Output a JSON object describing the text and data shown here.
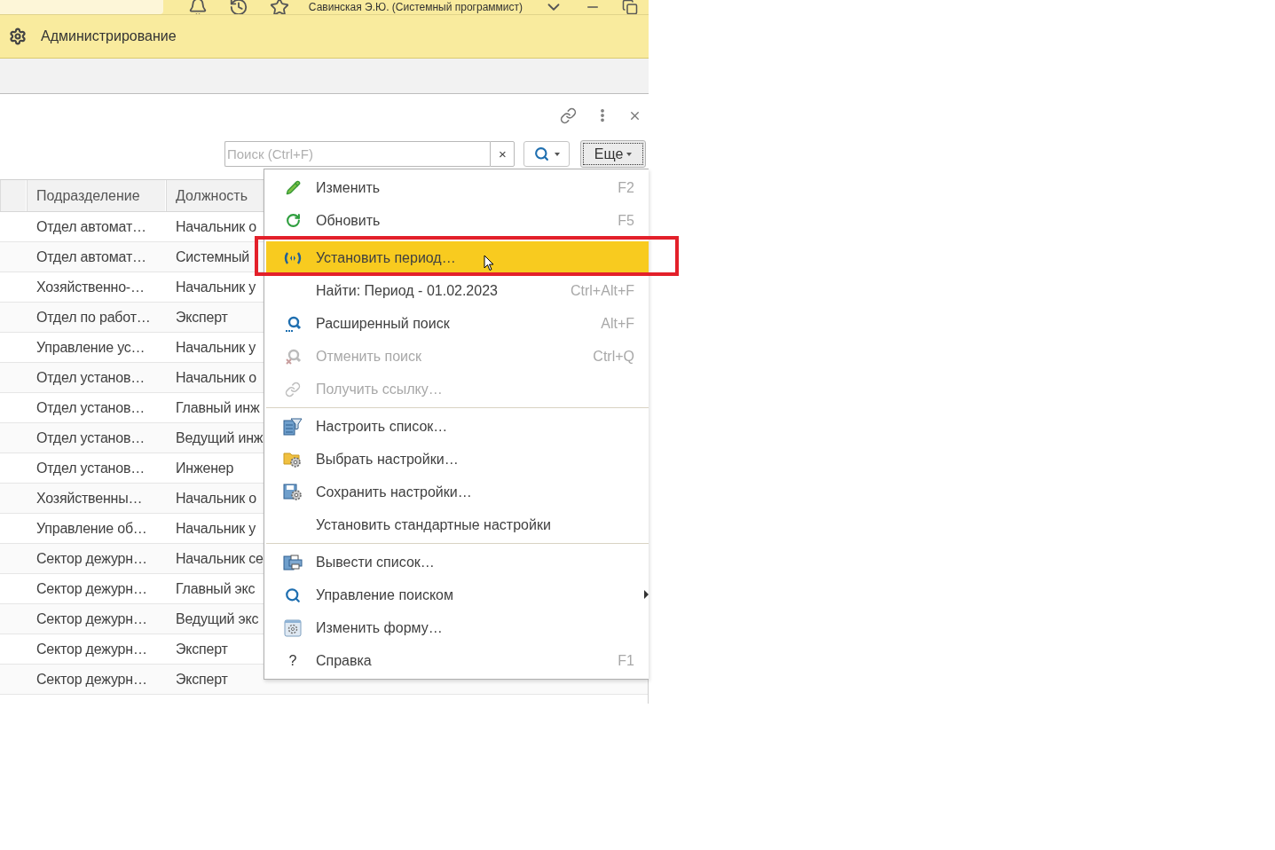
{
  "top_bar": {
    "user": "Савинская Э.Ю. (Системный программист)"
  },
  "section": {
    "title": "Администрирование"
  },
  "search": {
    "placeholder": "Поиск (Ctrl+F)",
    "clear": "×",
    "more": "Еще"
  },
  "table": {
    "columns": [
      "Подразделение",
      "Должность"
    ],
    "rows": [
      {
        "cells": [
          "Отдел автомат…",
          "Начальник о"
        ]
      },
      {
        "cells": [
          "Отдел автомат…",
          "Системный"
        ]
      },
      {
        "cells": [
          "Хозяйственно-…",
          "Начальник у"
        ]
      },
      {
        "cells": [
          "Отдел по работ…",
          "Эксперт"
        ]
      },
      {
        "cells": [
          "Управление ус…",
          "Начальник у"
        ]
      },
      {
        "cells": [
          "Отдел установ…",
          "Начальник о"
        ]
      },
      {
        "cells": [
          "Отдел установ…",
          "Главный инж"
        ]
      },
      {
        "cells": [
          "Отдел установ…",
          "Ведущий инж"
        ]
      },
      {
        "cells": [
          "Отдел установ…",
          "Инженер"
        ]
      },
      {
        "cells": [
          "Хозяйственны…",
          "Начальник о"
        ]
      },
      {
        "cells": [
          "Управление об…",
          "Начальник у"
        ]
      },
      {
        "cells": [
          "Сектор дежурн…",
          "Начальник се"
        ]
      },
      {
        "cells": [
          "Сектор дежурн…",
          "Главный экс"
        ]
      },
      {
        "cells": [
          "Сектор дежурн…",
          "Ведущий экс"
        ]
      },
      {
        "cells": [
          "Сектор дежурн…",
          "Эксперт"
        ]
      },
      {
        "cells": [
          "Сектор дежурн…",
          "Эксперт"
        ]
      }
    ]
  },
  "menu": {
    "groups": [
      [
        {
          "label": "Изменить",
          "shortcut": "F2",
          "selected": false,
          "disabled": false,
          "submenu": false
        },
        {
          "label": "Обновить",
          "shortcut": "F5",
          "selected": false,
          "disabled": false,
          "submenu": false
        }
      ],
      [
        {
          "label": "Установить период…",
          "selected": true,
          "disabled": false,
          "submenu": false
        },
        {
          "label": "Найти: Период - 01.02.2023",
          "shortcut": "Ctrl+Alt+F",
          "selected": false,
          "disabled": false,
          "submenu": false
        },
        {
          "label": "Расширенный поиск",
          "shortcut": "Alt+F",
          "selected": false,
          "disabled": false,
          "submenu": false
        },
        {
          "label": "Отменить поиск",
          "shortcut": "Ctrl+Q",
          "selected": false,
          "disabled": true,
          "submenu": false
        },
        {
          "label": "Получить ссылку…",
          "selected": false,
          "disabled": true,
          "submenu": false
        }
      ],
      [
        {
          "label": "Настроить список…",
          "selected": false,
          "disabled": false,
          "submenu": false
        },
        {
          "label": "Выбрать настройки…",
          "selected": false,
          "disabled": false,
          "submenu": false
        },
        {
          "label": "Сохранить настройки…",
          "selected": false,
          "disabled": false,
          "submenu": false
        },
        {
          "label": "Установить стандартные настройки",
          "selected": false,
          "disabled": false,
          "submenu": false
        }
      ],
      [
        {
          "label": "Вывести список…",
          "selected": false,
          "disabled": false,
          "submenu": false
        },
        {
          "label": "Управление поиском",
          "selected": false,
          "disabled": false,
          "submenu": true
        },
        {
          "label": "Изменить форму…",
          "selected": false,
          "disabled": false,
          "submenu": false
        },
        {
          "label": "Справка",
          "glyph": "?",
          "shortcut": "F1",
          "selected": false,
          "disabled": false,
          "submenu": false
        }
      ]
    ]
  }
}
